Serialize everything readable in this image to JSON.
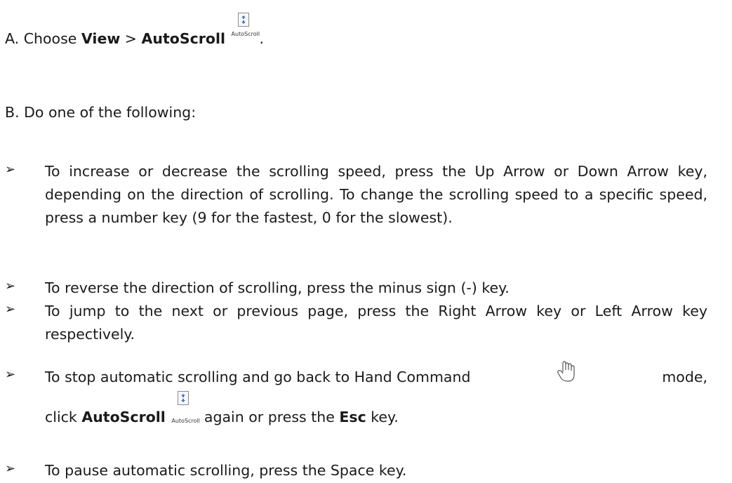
{
  "step_a": {
    "prefix": "A. Choose ",
    "menu": "View",
    "separator": " > ",
    "command": "AutoScroll",
    "icon_caption": "AutoScroll",
    "suffix": "."
  },
  "step_b": "B. Do one of the following:",
  "bullets": {
    "speed": "To increase or decrease the scrolling speed, press the Up Arrow or Down Arrow key, depending on the direction of scrolling. To change the scrolling speed to a specific speed, press a number key (9 for the fastest, 0 for the slowest).",
    "reverse": "To reverse the direction of scrolling, press the minus sign (-) key.",
    "jump": "To jump to the next or previous page, press the Right Arrow key or Left Arrow key respectively.",
    "stop": {
      "part1": "To stop automatic scrolling and go back to Hand Command",
      "part2": "mode,",
      "part3": "click ",
      "command": "AutoScroll",
      "icon_caption": "AutoScroll",
      "part4": " again or press the ",
      "key": "Esc",
      "part5": " key."
    },
    "pause": "To pause automatic scrolling, press the Space key."
  },
  "bullet_symbol": "➢",
  "icons": [
    "autoscroll-icon",
    "hand-icon",
    "arrow-bullet-icon"
  ]
}
